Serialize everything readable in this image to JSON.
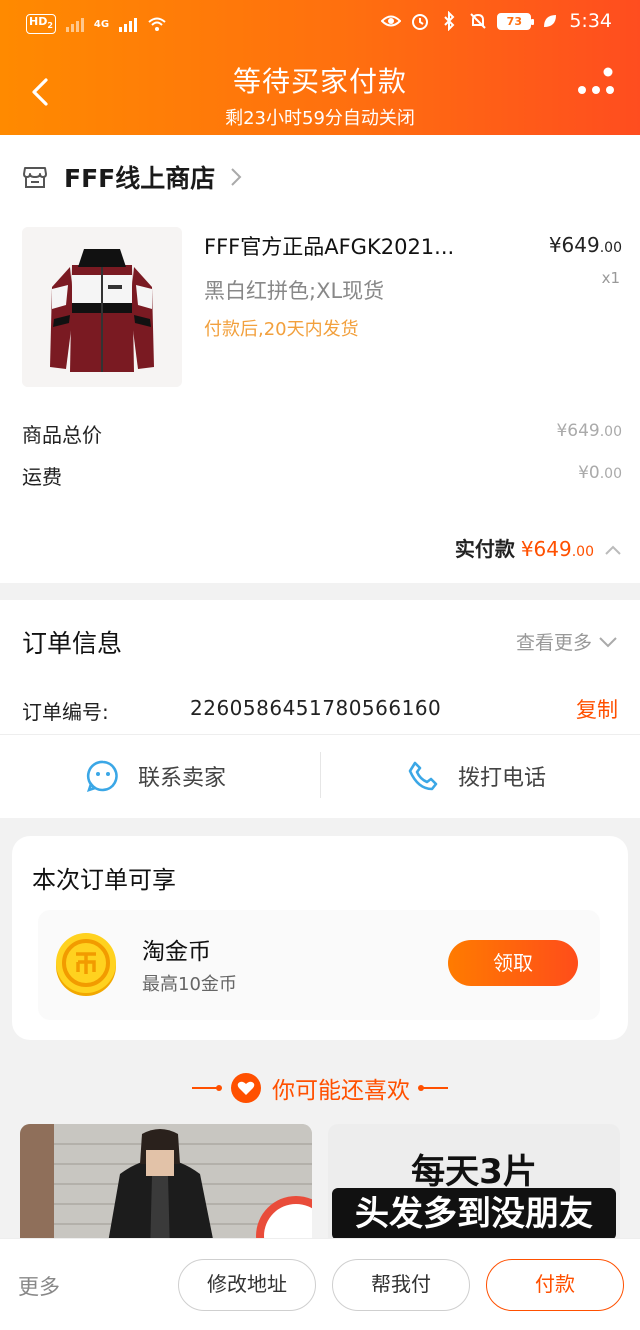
{
  "status_bar": {
    "hd_label": "HD",
    "hd_sub": "2",
    "network": "4G",
    "battery": "73",
    "time": "5:34"
  },
  "header": {
    "title": "等待买家付款",
    "subtitle": "剩23小时59分自动关闭"
  },
  "shop": {
    "name": "FFF线上商店"
  },
  "product": {
    "title": "FFF官方正品AFGK2021...",
    "spec": "黑白红拼色;XL现货",
    "shipping_note": "付款后,20天内发货",
    "price_main": "¥649",
    "price_decimal": ".00",
    "quantity": "x1"
  },
  "fees": {
    "subtotal_label": "商品总价",
    "subtotal_main": "¥649",
    "subtotal_decimal": ".00",
    "shipping_label": "运费",
    "shipping_main": "¥0",
    "shipping_decimal": ".00",
    "total_label": "实付款",
    "total_main": "¥649",
    "total_decimal": ".00"
  },
  "order_info": {
    "title": "订单信息",
    "more_label": "查看更多",
    "order_no_label": "订单编号:",
    "order_no": "2260586451780566160",
    "copy_label": "复制",
    "contact_seller": "联系卖家",
    "call_phone": "拨打电话"
  },
  "benefits": {
    "title": "本次订单可享",
    "coin_name": "淘金币",
    "coin_desc": "最高10金币",
    "claim_label": "领取"
  },
  "recommend": {
    "title": "你可能还喜欢",
    "card2_line1": "每天3片",
    "card2_line2": "头发多到没朋友"
  },
  "bottom_bar": {
    "more_label": "更多",
    "change_address": "修改地址",
    "help_pay": "帮我付",
    "pay": "付款"
  },
  "colors": {
    "accent": "#ff5000",
    "header_start": "#ff8a00",
    "header_end": "#ff4d1f",
    "shipping_note": "#f2a03d"
  }
}
